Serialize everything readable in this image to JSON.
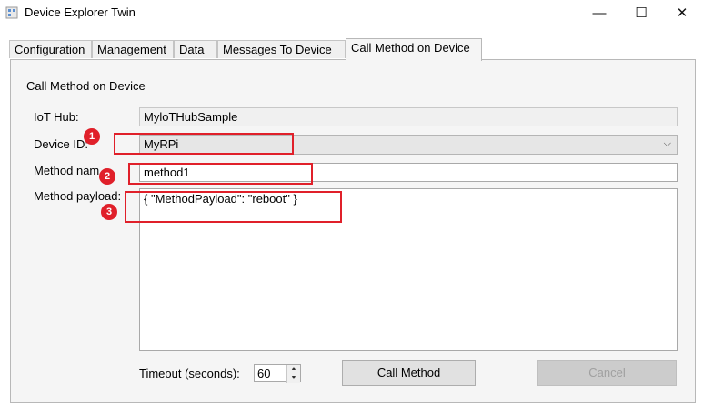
{
  "window": {
    "title": "Device Explorer Twin",
    "controls": {
      "minimize": "—",
      "maximize": "☐",
      "close": "✕"
    }
  },
  "tabs": [
    {
      "label": "Configuration"
    },
    {
      "label": "Management"
    },
    {
      "label": "Data"
    },
    {
      "label": "Messages To Device"
    },
    {
      "label": "Call Method on Device"
    }
  ],
  "active_tab": "Call Method on Device",
  "panel": {
    "heading": "Call Method on Device",
    "iot_hub": {
      "label": "IoT Hub:",
      "value": "MyloTHubSample"
    },
    "device_id": {
      "label": "Device ID:",
      "value": "MyRPi"
    },
    "method_name": {
      "label": "Method nam",
      "value": "method1"
    },
    "method_payload": {
      "label": "Method payload:",
      "value": "{ \"MethodPayload\": \"reboot\" }"
    },
    "timeout": {
      "label": "Timeout (seconds):",
      "value": "60"
    },
    "call_button": "Call Method",
    "cancel_button": "Cancel"
  },
  "annotations": [
    "1",
    "2",
    "3"
  ],
  "colors": {
    "annotation_red": "#e0202a",
    "panel_bg": "#f5f5f5"
  }
}
